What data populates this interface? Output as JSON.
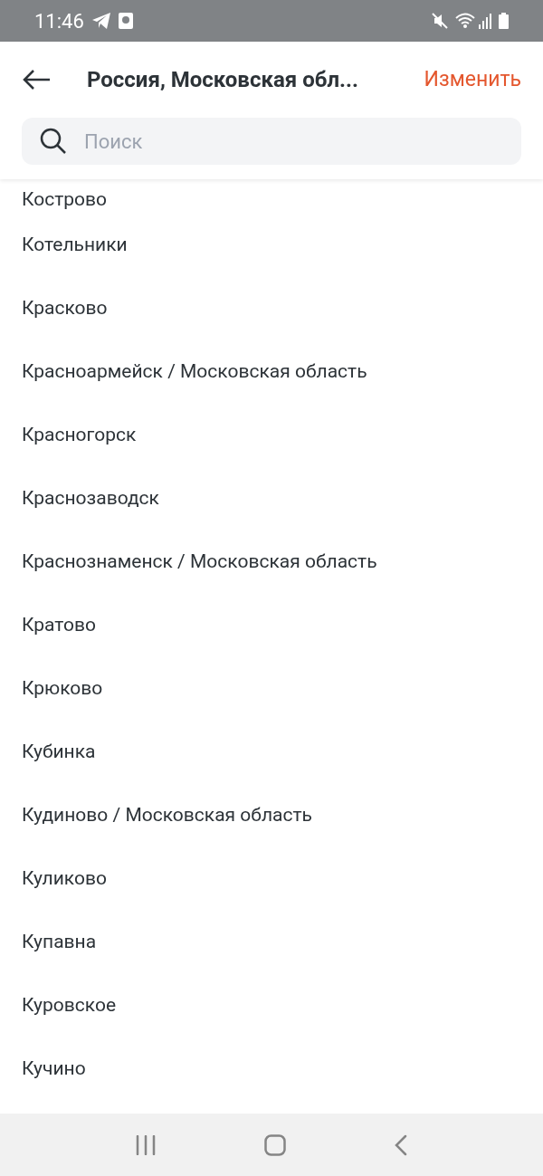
{
  "status_bar": {
    "time": "11:46"
  },
  "header": {
    "title": "Россия, Московская обл...",
    "action": "Изменить"
  },
  "search": {
    "placeholder": "Поиск"
  },
  "cities": [
    "Кострово",
    "Котельники",
    "Красково",
    "Красноармейск / Московская область",
    "Красногорск",
    "Краснозаводск",
    "Краснознаменск / Московская область",
    "Кратово",
    "Крюково",
    "Кубинка",
    "Кудиново / Московская область",
    "Куликово",
    "Купавна",
    "Куровское",
    "Кучино"
  ]
}
